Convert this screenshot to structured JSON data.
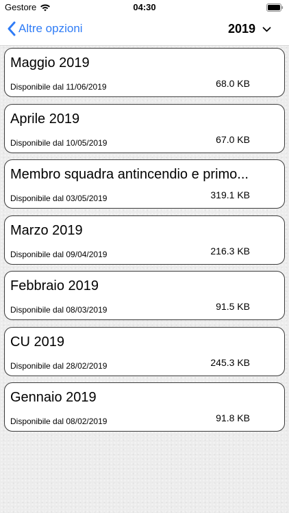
{
  "status_bar": {
    "carrier": "Gestore",
    "time": "04:30"
  },
  "nav": {
    "back_label": "Altre opzioni",
    "year": "2019",
    "accent_color": "#2f7cf6"
  },
  "documents": [
    {
      "title": "Maggio 2019",
      "date": "Disponibile dal 11/06/2019",
      "size": "68.0 KB"
    },
    {
      "title": "Aprile 2019",
      "date": "Disponibile dal 10/05/2019",
      "size": "67.0 KB"
    },
    {
      "title": "Membro squadra antincendio e primo...",
      "date": "Disponibile dal 03/05/2019",
      "size": "319.1 KB"
    },
    {
      "title": "Marzo 2019",
      "date": "Disponibile dal 09/04/2019",
      "size": "216.3 KB"
    },
    {
      "title": "Febbraio 2019",
      "date": "Disponibile dal 08/03/2019",
      "size": "91.5 KB"
    },
    {
      "title": "CU 2019",
      "date": "Disponibile dal 28/02/2019",
      "size": "245.3 KB"
    },
    {
      "title": "Gennaio 2019",
      "date": "Disponibile dal 08/02/2019",
      "size": "91.8 KB"
    }
  ]
}
